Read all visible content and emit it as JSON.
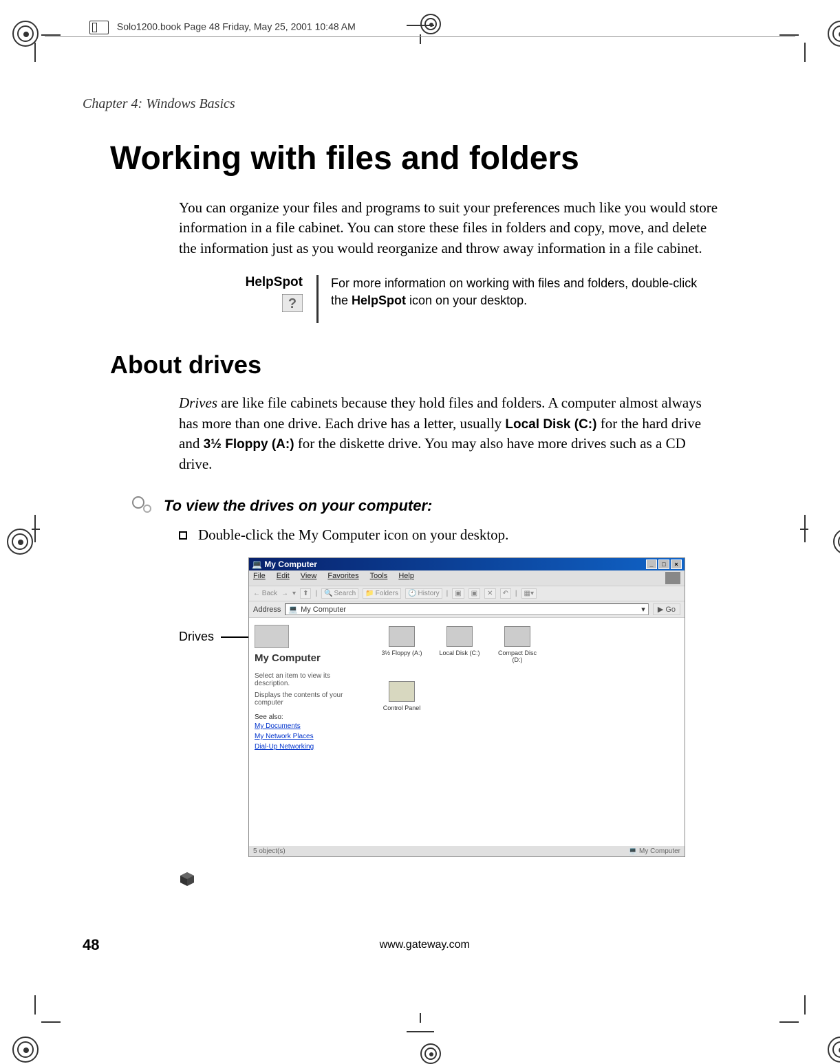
{
  "bookInfo": "Solo1200.book  Page 48  Friday, May 25, 2001  10:48 AM",
  "chapterLabel": "Chapter 4: Windows Basics",
  "mainHeading": "Working with files and folders",
  "para1": "You can organize your files and programs to suit your preferences much like you would store information in a file cabinet. You can store these files in folders and copy, move, and delete the information just as you would reorganize and throw away information in a file cabinet.",
  "helpSpot": {
    "label": "HelpSpot",
    "text_before": "For more information on working with files and folders, double-click the ",
    "text_bold": "HelpSpot",
    "text_after": " icon on your desktop."
  },
  "subHeading": "About drives",
  "para2_1": "Drives",
  "para2_2": " are like file cabinets because they hold files and folders. A computer almost always has more than one drive. Each drive has a letter, usually ",
  "para2_bold1": "Local Disk (C:)",
  "para2_3": " for the hard drive and ",
  "para2_bold2": "3½ Floppy (A:)",
  "para2_4": " for the diskette drive. You may also have more drives such as a CD drive.",
  "instruction": "To view the drives on your computer:",
  "bullet_before": "Double-click the ",
  "bullet_bold": "My Computer",
  "bullet_after": " icon on your desktop.",
  "calloutLabel": "Drives",
  "screenshot": {
    "title": "My Computer",
    "menus": [
      "File",
      "Edit",
      "View",
      "Favorites",
      "Tools",
      "Help"
    ],
    "toolbar": {
      "search": "Search",
      "folders": "Folders",
      "history": "History"
    },
    "address": {
      "label": "Address",
      "value": "My Computer",
      "go": "Go"
    },
    "leftPane": {
      "title": "My Computer",
      "desc1": "Select an item to view its description.",
      "desc2": "Displays the contents of your computer",
      "seeAlso": "See also:",
      "links": [
        "My Documents",
        "My Network Places",
        "Dial-Up Networking"
      ],
      "cpLabel": "Control Panel"
    },
    "drives": [
      {
        "label": "3½ Floppy (A:)"
      },
      {
        "label": "Local Disk (C:)"
      },
      {
        "label": "Compact Disc (D:)"
      }
    ],
    "controlPanel": "Control Panel",
    "statusLeft": "5 object(s)",
    "statusRight": "My Computer"
  },
  "pageNumber": "48",
  "footerUrl": "www.gateway.com"
}
